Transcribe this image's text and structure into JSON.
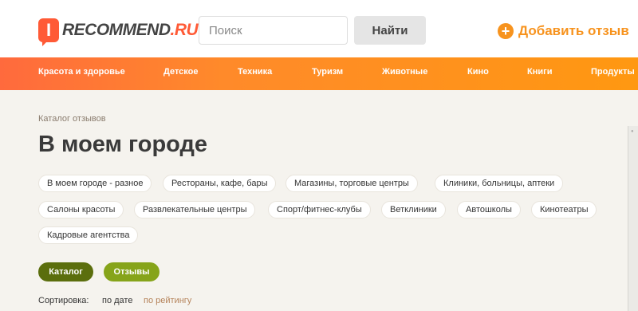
{
  "header": {
    "logo_mark": "I",
    "logo_name": "RECOMMEND",
    "logo_suffix": ".RU",
    "search_placeholder": "Поиск",
    "search_button": "Найти",
    "add_review_icon": "plus-circle-icon",
    "add_review": "Добавить отзыв"
  },
  "nav": {
    "items": [
      "Красота и здоровье",
      "Детское",
      "Техника",
      "Туризм",
      "Животные",
      "Кино",
      "Книги",
      "Продукты"
    ]
  },
  "page": {
    "breadcrumb": "Каталог отзывов",
    "title": "В моем городе",
    "tags": [
      "В моем городе - разное",
      "Рестораны, кафе, бары",
      "Магазины, торговые центры",
      "Клиники, больницы, аптеки",
      "Салоны красоты",
      "Развлекательные центры",
      "Спорт/фитнес-клубы",
      "Ветклиники",
      "Автошколы",
      "Кинотеатры",
      "Кадровые агентства"
    ],
    "tabs": [
      "Каталог",
      "Отзывы"
    ],
    "sort_label": "Сортировка:",
    "sort_by_date": "по дате",
    "sort_by_rating": "по рейтингу"
  },
  "colors": {
    "brand": "#ff5a36",
    "accent": "#f7931e",
    "tab_active": "#5b6e0d",
    "tab_inactive": "#86a41a"
  }
}
